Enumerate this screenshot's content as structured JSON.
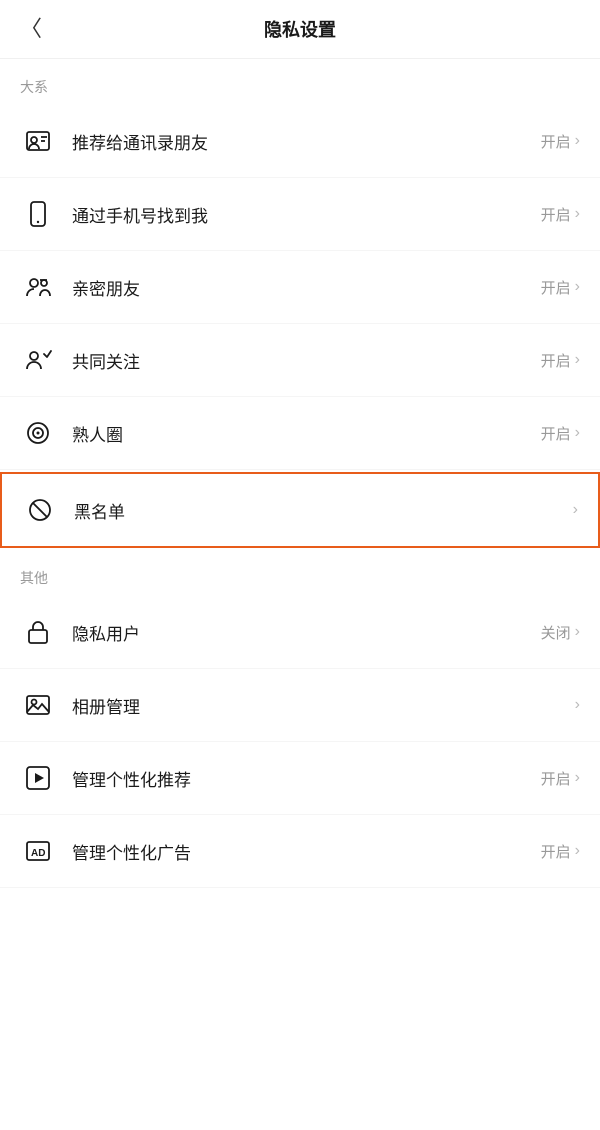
{
  "header": {
    "title": "隐私设置",
    "back_label": "‹"
  },
  "sections": [
    {
      "label": "大系",
      "label_id": "section-dashu",
      "items": [
        {
          "id": "recommend-contacts",
          "icon": "contact-card",
          "text": "推荐给通讯录朋友",
          "status": "开启",
          "hasChevron": true,
          "highlighted": false
        },
        {
          "id": "find-by-phone",
          "icon": "phone",
          "text": "通过手机号找到我",
          "status": "开启",
          "hasChevron": true,
          "highlighted": false
        },
        {
          "id": "close-friends",
          "icon": "close-friends",
          "text": "亲密朋友",
          "status": "开启",
          "hasChevron": true,
          "highlighted": false
        },
        {
          "id": "mutual-follow",
          "icon": "mutual-follow",
          "text": "共同关注",
          "status": "开启",
          "hasChevron": true,
          "highlighted": false
        },
        {
          "id": "acquaintance-circle",
          "icon": "acquaintance",
          "text": "熟人圈",
          "status": "开启",
          "hasChevron": true,
          "highlighted": false
        },
        {
          "id": "blacklist",
          "icon": "block",
          "text": "黑名单",
          "status": "",
          "hasChevron": true,
          "highlighted": true
        }
      ]
    },
    {
      "label": "其他",
      "label_id": "section-other",
      "items": [
        {
          "id": "private-user",
          "icon": "lock",
          "text": "隐私用户",
          "status": "关闭",
          "hasChevron": true,
          "highlighted": false
        },
        {
          "id": "album-manage",
          "icon": "album",
          "text": "相册管理",
          "status": "",
          "hasChevron": true,
          "highlighted": false
        },
        {
          "id": "manage-personalized",
          "icon": "play",
          "text": "管理个性化推荐",
          "status": "开启",
          "hasChevron": true,
          "highlighted": false
        },
        {
          "id": "manage-ads",
          "icon": "ad",
          "text": "管理个性化广告",
          "status": "开启",
          "hasChevron": true,
          "highlighted": false
        }
      ]
    }
  ]
}
